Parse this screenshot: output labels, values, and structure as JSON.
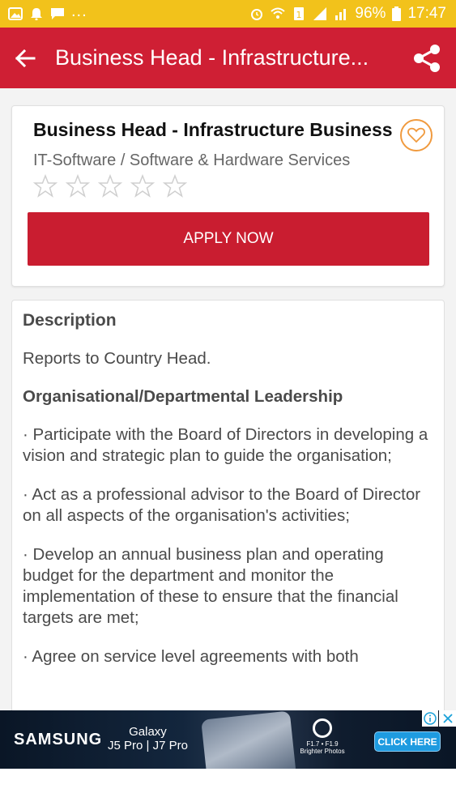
{
  "status_bar": {
    "battery": "96%",
    "time": "17:47",
    "overflow": "..."
  },
  "app_bar": {
    "title": "Business Head - Infrastructure...",
    "back_icon": "arrow-left-icon",
    "share_icon": "share-icon"
  },
  "job": {
    "title": "Business Head - Infrastructure Business",
    "industry": "IT-Software / Software & Hardware Services",
    "rating": 0,
    "rating_max": 5,
    "apply_label": "APPLY NOW",
    "favorite_icon": "heart-icon"
  },
  "description": {
    "heading": "Description",
    "reports_to": "Reports to Country Head.",
    "section_heading": "Organisational/Departmental Leadership",
    "bullets": [
      "·  Participate with the Board of Directors in developing a vision and strategic plan to guide the organisation;",
      "·   Act as a professional advisor to the Board of Director on all aspects of the organisation's activities;",
      "·   Develop an annual business plan and operating budget for the department and monitor the implementation of these to ensure that the financial targets are met;",
      "·  Agree on service level agreements with both"
    ]
  },
  "ad": {
    "brand": "SAMSUNG",
    "product_line1": "Galaxy",
    "product_line2": "J5 Pro | J7 Pro",
    "camera_line1": "F1.7 • F1.9",
    "camera_line2": "Brighter Photos",
    "cta": "CLICK HERE"
  },
  "colors": {
    "status_bar": "#f2c21b",
    "app_bar": "#cf1f34",
    "apply_button": "#c91d30",
    "favorite_ring": "#f09a3e"
  }
}
